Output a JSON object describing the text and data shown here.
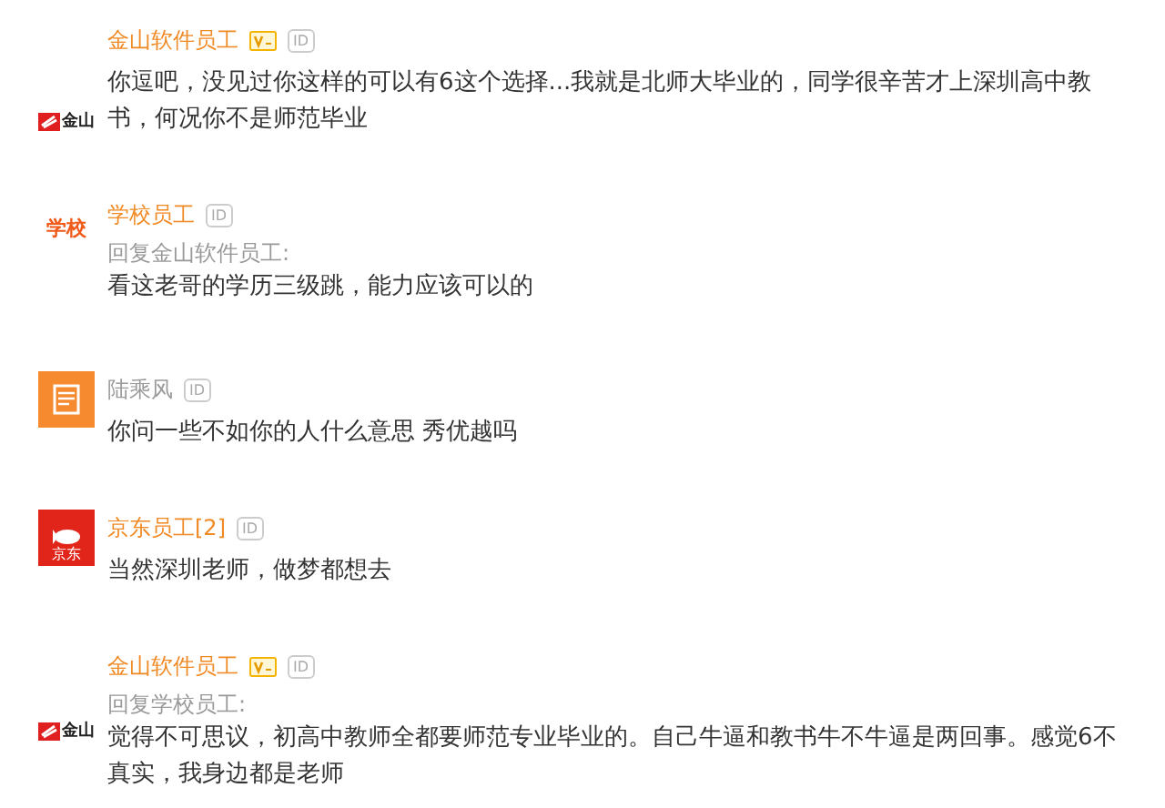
{
  "comments": [
    {
      "avatar": {
        "kind": "kingsoft",
        "text": "金山"
      },
      "name": "金山软件员工",
      "color": "#f08a24",
      "verified": true,
      "id_badge": "ID",
      "text": "你逗吧，没见过你这样的可以有6这个选择...我就是北师大毕业的，同学很辛苦才上深圳高中教书，何况你不是师范毕业"
    },
    {
      "avatar": {
        "kind": "school",
        "text": "学校"
      },
      "name": "学校员工",
      "color": "#f08a24",
      "verified": false,
      "id_badge": "ID",
      "reply_to": "回复金山软件员工:",
      "text": "看这老哥的学历三级跳，能力应该可以的"
    },
    {
      "avatar": {
        "kind": "document"
      },
      "name": "陆乘风",
      "color": "#9a9a9a",
      "verified": false,
      "id_badge": "ID",
      "text": "你问一些不如你的人什么意思 秀优越吗"
    },
    {
      "avatar": {
        "kind": "jd",
        "text": "京东"
      },
      "name": "京东员工[2]",
      "color": "#f08a24",
      "verified": false,
      "id_badge": "ID",
      "text": "当然深圳老师，做梦都想去"
    },
    {
      "avatar": {
        "kind": "kingsoft",
        "text": "金山"
      },
      "name": "金山软件员工",
      "color": "#f08a24",
      "verified": true,
      "id_badge": "ID",
      "reply_to": "回复学校员工:",
      "text": "觉得不可思议，初高中教师全都要师范专业毕业的。自己牛逼和教书牛不牛逼是两回事。感觉6不真实，我身边都是老师"
    }
  ]
}
